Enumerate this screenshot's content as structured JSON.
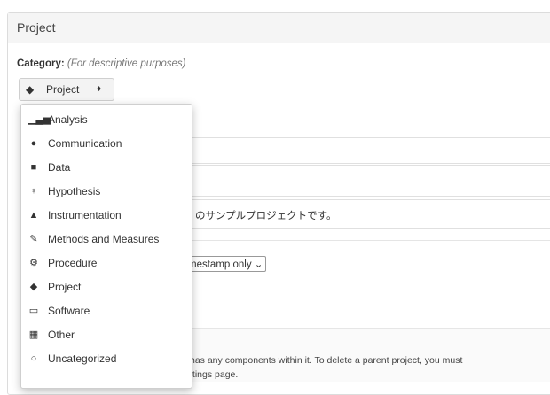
{
  "panel": {
    "title": "Project"
  },
  "category": {
    "label": "Category:",
    "hint": "(For descriptive purposes)"
  },
  "category_select": {
    "value": "Project",
    "icon": "project-icon",
    "caret": "♦"
  },
  "menu": {
    "items": [
      {
        "label": "Analysis",
        "icon": "bar-chart-icon",
        "glyph": "▁▃▅"
      },
      {
        "label": "Communication",
        "icon": "comment-icon",
        "glyph": "●"
      },
      {
        "label": "Data",
        "icon": "database-icon",
        "glyph": "■"
      },
      {
        "label": "Hypothesis",
        "icon": "lightbulb-icon",
        "glyph": "♀"
      },
      {
        "label": "Instrumentation",
        "icon": "flask-icon",
        "glyph": "▲"
      },
      {
        "label": "Methods and Measures",
        "icon": "pencil-icon",
        "glyph": "✎"
      },
      {
        "label": "Procedure",
        "icon": "cogs-icon",
        "glyph": "⚙"
      },
      {
        "label": "Project",
        "icon": "cube-icon",
        "glyph": "◆"
      },
      {
        "label": "Software",
        "icon": "laptop-icon",
        "glyph": "▭"
      },
      {
        "label": "Other",
        "icon": "th-large-icon",
        "glyph": "▦"
      },
      {
        "label": "Uncategorized",
        "icon": "circle-o-icon",
        "glyph": "○"
      }
    ]
  },
  "description_text": "のサンプルプロジェクトです。",
  "timestamp_select": {
    "value": "mestamp only"
  },
  "notes": {
    "line1": "has any components within it. To delete a parent project, you must",
    "line2": "ttings page."
  }
}
